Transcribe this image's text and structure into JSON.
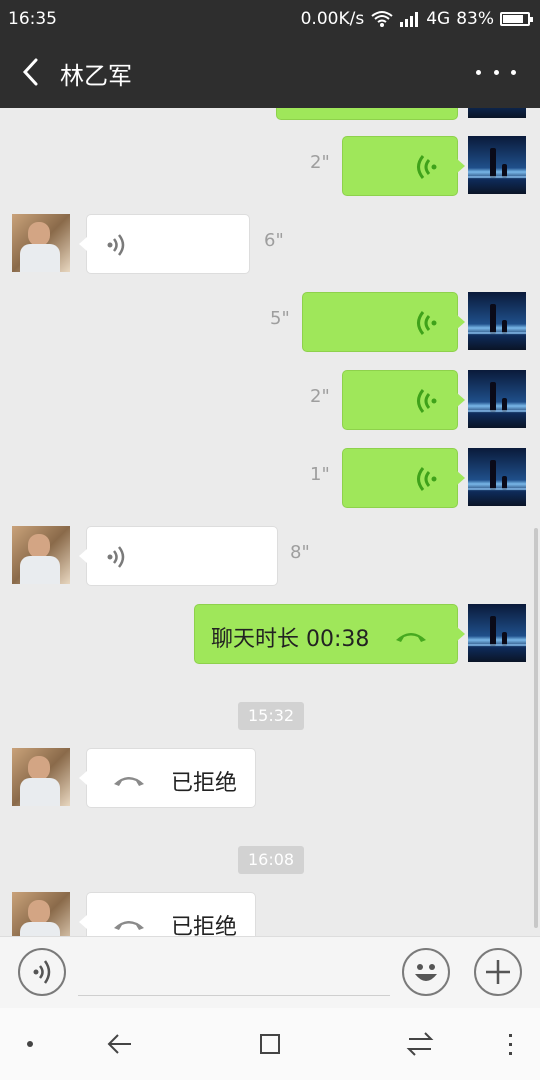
{
  "status": {
    "time": "16:35",
    "speed": "0.00K/s",
    "network": "4G",
    "battery": "83%",
    "battery_level": 0.83
  },
  "header": {
    "title": "林乙军"
  },
  "messages": [
    {
      "from": "me",
      "type": "voice",
      "duration": "2\""
    },
    {
      "from": "them",
      "type": "voice",
      "duration": "6\""
    },
    {
      "from": "me",
      "type": "voice",
      "duration": "5\""
    },
    {
      "from": "me",
      "type": "voice",
      "duration": "2\""
    },
    {
      "from": "me",
      "type": "voice",
      "duration": "1\""
    },
    {
      "from": "them",
      "type": "voice",
      "duration": "8\""
    },
    {
      "from": "me",
      "type": "call",
      "text": "聊天时长 00:38"
    },
    {
      "type": "time",
      "text": "15:32"
    },
    {
      "from": "them",
      "type": "call",
      "text": "已拒绝"
    },
    {
      "type": "time",
      "text": "16:08"
    },
    {
      "from": "them",
      "type": "call",
      "text": "已拒绝"
    }
  ],
  "icons": {
    "back": "chevron-left-icon",
    "more": "more-dots-icon",
    "voice_mode": "voice-icon",
    "emoji": "emoji-icon",
    "plus": "plus-icon"
  },
  "colors": {
    "my_bubble": "#9fe75a",
    "their_bubble": "#ffffff",
    "header": "#2e2e2e",
    "voice_wave_me": "#3fa21a"
  }
}
